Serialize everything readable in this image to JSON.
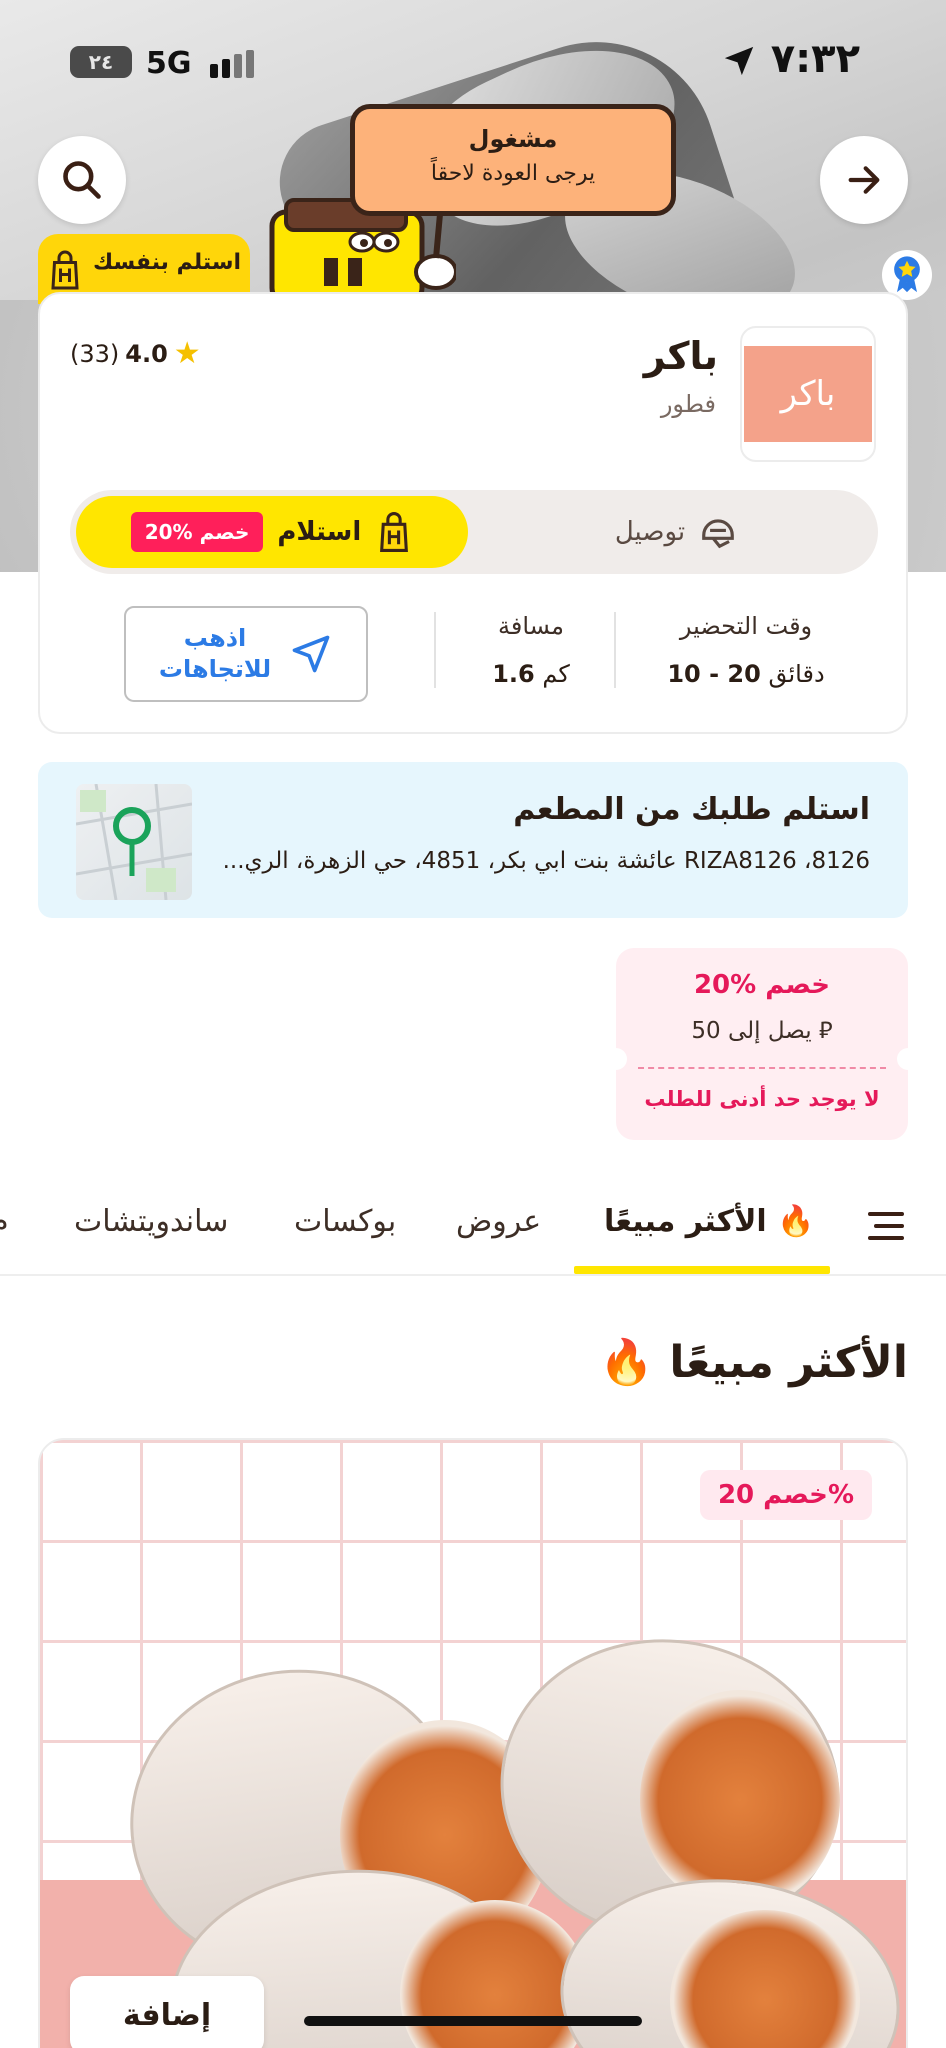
{
  "status_bar": {
    "time": "٧:٣٢",
    "network": "5G",
    "battery": "٢٤"
  },
  "header": {
    "busy_title": "مشغول",
    "busy_subtitle": "يرجى العودة لاحقاً",
    "pickup_tag": "استلم بنفسك"
  },
  "restaurant": {
    "name": "باكر",
    "category": "فطور",
    "logo_text": "باكر",
    "rating": "4.0",
    "reviews": "(33)"
  },
  "modes": {
    "delivery_label": "توصيل",
    "pickup_label": "استلام",
    "pickup_discount": "20% خصم"
  },
  "stats": {
    "prep_label": "وقت التحضير",
    "prep_value": "10 - 20",
    "prep_unit": "دقائق",
    "distance_label": "مسافة",
    "distance_value": "1.6",
    "distance_unit": "كم",
    "directions_line1": "اذهب",
    "directions_line2": "للاتجاهات"
  },
  "pickup_info": {
    "title": "استلم طلبك من المطعم",
    "address": "RIZA8126 ،8126 عائشة بنت ابي بكر، 4851، حي الزهرة، الري..."
  },
  "coupon": {
    "title": "20% خصم",
    "cap": "يصل إلى 50 ⃁",
    "min_order": "لا يوجد حد أدنى للطلب"
  },
  "tabs": [
    {
      "label": "الأكثر مبيعًا"
    },
    {
      "label": "عروض"
    },
    {
      "label": "بوكسات"
    },
    {
      "label": "ساندويتشات"
    },
    {
      "label": "م"
    }
  ],
  "section": {
    "title": "الأكثر مبيعًا"
  },
  "product": {
    "discount": "خصم 20%",
    "add_label": "إضافة"
  },
  "colors": {
    "accent_yellow": "#ffe600",
    "discount_pink": "#e5195a",
    "link_blue": "#2c7be5"
  }
}
